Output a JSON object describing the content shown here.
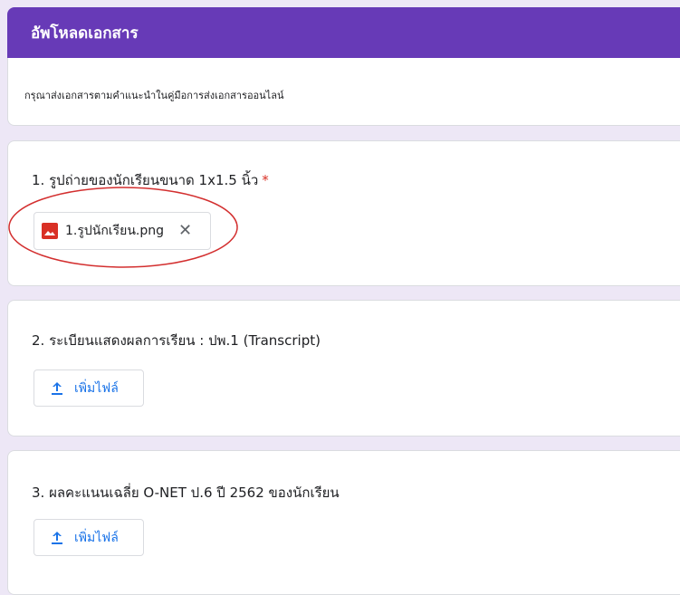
{
  "section": {
    "title": "อัพโหลดเอกสาร",
    "description": "กรุณาส่งเอกสารตามคำแนะนำในคู่มือการส่งเอกสารออนไลน์"
  },
  "questions": [
    {
      "title": "1. รูปถ่ายของนักเรียนขนาด 1x1.5 นิ้ว",
      "required_mark": "*",
      "uploaded_file": {
        "name": "1.รูปนักเรียน.png",
        "icon": "image-file-icon",
        "remove_icon": "close-icon",
        "remove_glyph": "✕"
      }
    },
    {
      "title": "2. ระเบียนแสดงผลการเรียน : ปพ.1 (Transcript)",
      "add_file_label": "เพิ่มไฟล์",
      "add_file_icon": "upload-icon"
    },
    {
      "title": "3. ผลคะแนนเฉลี่ย O-NET ป.6 ปี 2562 ของนักเรียน",
      "add_file_label": "เพิ่มไฟล์",
      "add_file_icon": "upload-icon"
    }
  ],
  "colors": {
    "header_bg": "#673ab7",
    "page_bg": "#ede7f6",
    "accent_blue": "#1a73e8",
    "required_red": "#d93025",
    "image_icon_red": "#d93025",
    "annotation_red": "#d32f2f"
  }
}
